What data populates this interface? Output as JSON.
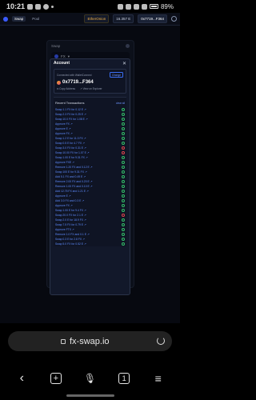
{
  "status_bar": {
    "time": "10:21",
    "battery": "89%"
  },
  "app_bar": {
    "nav": [
      "Swap",
      "Pool"
    ],
    "network": "EtherOnion",
    "balance": "16.357 E",
    "wallet_short": "0x7719...F364"
  },
  "swap_card": {
    "title": "Swap",
    "token": "FX"
  },
  "modal": {
    "title": "Account",
    "connected_label": "Connected with WalletConnect",
    "change_label": "Change",
    "address": "0x7719...F364",
    "copy_label": "Copy Address",
    "view_label": "View on Explorer",
    "recent_label": "Recent Transactions",
    "clear_label": "clear all",
    "transactions": [
      {
        "label": "Swap 1.1 FX for 0.12 E ↗",
        "status": "ok"
      },
      {
        "label": "Swap 2.3 FX for 0.25 E ↗",
        "status": "ok"
      },
      {
        "label": "Swap 10.0 FX for 1.08 E ↗",
        "status": "ok"
      },
      {
        "label": "Approve FX ↗",
        "status": "ok"
      },
      {
        "label": "Approve E ↗",
        "status": "ok"
      },
      {
        "label": "Approve FX ↗",
        "status": "ok"
      },
      {
        "label": "Swap 1.2 E for 11.3 FX ↗",
        "status": "ok"
      },
      {
        "label": "Swap 0.5 E for 4.7 FX ↗",
        "status": "ok"
      },
      {
        "label": "Swap 3.0 FX for 0.31 E ↗",
        "status": "fail"
      },
      {
        "label": "Swap 10.00 FX for 1.07 E ↗",
        "status": "fail"
      },
      {
        "label": "Swap 1.00 E for 9.31 FX ↗",
        "status": "ok"
      },
      {
        "label": "Approve FXE ↗",
        "status": "ok"
      },
      {
        "label": "Remove 1.20 FX and 0.12 E ↗",
        "status": "ok"
      },
      {
        "label": "Swap 100 E for 9.31 FX ↗",
        "status": "ok"
      },
      {
        "label": "Add 5.1 FX and 0.49 E ↗",
        "status": "ok"
      },
      {
        "label": "Remove 2.00 FX and 0.20 E ↗",
        "status": "ok"
      },
      {
        "label": "Remove 1.00 FX and 0.10 E ↗",
        "status": "ok"
      },
      {
        "label": "Add 12.75 FX and 1.21 E ↗",
        "status": "ok"
      },
      {
        "label": "Approve E ↗",
        "status": "ok"
      },
      {
        "label": "Add 3.0 FX and 0.3 E ↗",
        "status": "ok"
      },
      {
        "label": "Approve FX ↗",
        "status": "ok"
      },
      {
        "label": "Swap 1.00 E for 9.4 FX ↗",
        "status": "ok"
      },
      {
        "label": "Swap 20.0 FX for 2.1 E ↗",
        "status": "fail"
      },
      {
        "label": "Swap 2.0 E for 18.9 FX ↗",
        "status": "ok"
      },
      {
        "label": "Swap 7.5 FX for 0.79 E ↗",
        "status": "ok"
      },
      {
        "label": "Approve FTX ↗",
        "status": "ok"
      },
      {
        "label": "Remove 1.0 FX and 0.1 E ↗",
        "status": "ok"
      },
      {
        "label": "Swap 0.3 E for 2.8 FX ↗",
        "status": "ok"
      },
      {
        "label": "Swap 5.0 FX for 0.52 E ↗",
        "status": "ok"
      }
    ]
  },
  "browser": {
    "url": "fx-swap.io",
    "tab_count": "1"
  }
}
